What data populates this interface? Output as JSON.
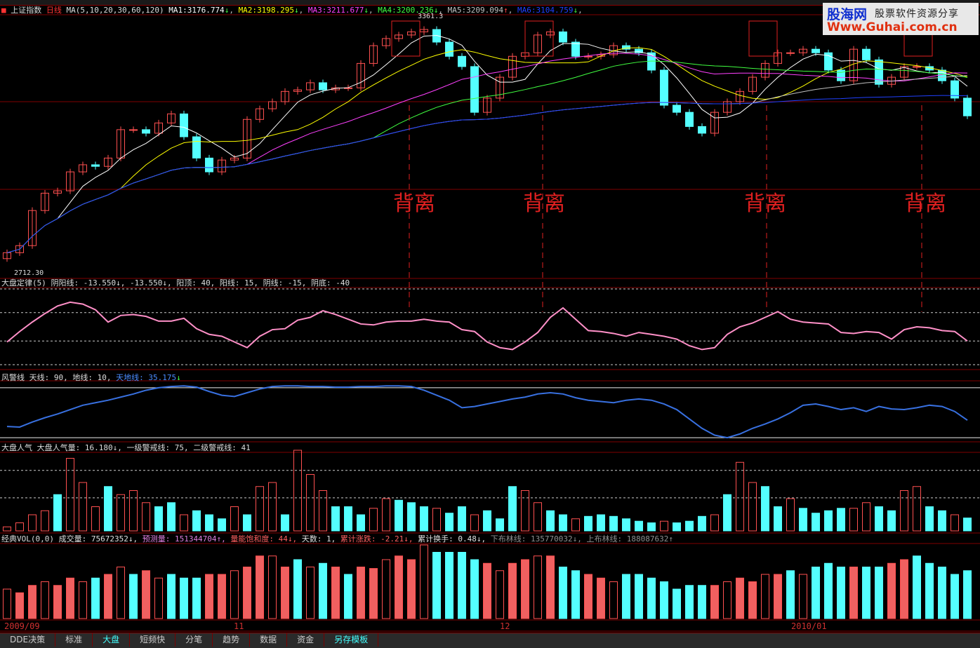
{
  "header": {
    "title": "上证指数",
    "period": "日线",
    "ma_params": "MA(5,10,20,30,60,120)",
    "ma": [
      {
        "label": "MA1:",
        "value": "3176.774",
        "arrow": "↓",
        "color": "#ffffff"
      },
      {
        "label": "MA2:",
        "value": "3198.295",
        "arrow": "↓",
        "color": "#ffff00"
      },
      {
        "label": "MA3:",
        "value": "3211.677",
        "arrow": "↓",
        "color": "#ff40ff"
      },
      {
        "label": "MA4:",
        "value": "3200.236",
        "arrow": "↓",
        "color": "#40ff40"
      },
      {
        "label": "MA5:",
        "value": "3209.094",
        "arrow": "↑",
        "color": "#c0c0c0"
      },
      {
        "label": "MA6:",
        "value": "3104.759",
        "arrow": "↓",
        "color": "#2040ff"
      }
    ]
  },
  "price_labels": {
    "high": "3361.3",
    "low": "2712.30"
  },
  "annotation_text": "背离",
  "panels": {
    "dpdl": {
      "title": "大盘定律(5)",
      "items": [
        "阴阳线: -13.550↓, -13.550↓, 阳顶: 40, 阳线: 15, 阴线: -15, 阴底: -40"
      ]
    },
    "fjx": {
      "title": "风警线",
      "fixed": "天线: 90, 地线: 10, ",
      "line_label": "天地线: 35.175",
      "arrow": "↓"
    },
    "rq": {
      "title": "大盘人气",
      "text": "大盘人气量: 16.180↓, 一级警戒线: 75, 二级警戒线: 41"
    },
    "vol": {
      "title": "经典VOL(0,0)",
      "parts": [
        {
          "t": "成交量: 75672352↓, ",
          "c": "#e0e0e0"
        },
        {
          "t": "预测量: 151344704↑, ",
          "c": "#e080e0"
        },
        {
          "t": "量能饱和度: 44↓, ",
          "c": "#ff6060"
        },
        {
          "t": "天数: 1, ",
          "c": "#e0e0e0"
        },
        {
          "t": "累计涨跌: -2.21↓, ",
          "c": "#ff6060"
        },
        {
          "t": "累计换手: 0.48↓, ",
          "c": "#e0e0e0"
        },
        {
          "t": "下布林线: 135770032↓, ",
          "c": "#909090"
        },
        {
          "t": "上布林线: 188087632↑",
          "c": "#909090"
        }
      ]
    }
  },
  "dates": [
    "2009/09",
    "11",
    "12",
    "2010/01"
  ],
  "tabs": [
    "DDE决策",
    "标准",
    "大盘",
    "短频快",
    "分笔",
    "趋势",
    "数据",
    "资金",
    "另存模板"
  ],
  "logo": {
    "name": "股海网",
    "slogan": "股票软件资源分享",
    "url": "Www.Guhai.com.cn"
  },
  "colors": {
    "up": "#ff5050",
    "down": "#54ffff",
    "grid": "#800000"
  },
  "chart_data": {
    "type": "candlestick",
    "ylim": [
      2712.3,
      3361.3
    ],
    "close": [
      2765,
      2783,
      2872,
      2916,
      2922,
      2970,
      2988,
      2984,
      3005,
      3077,
      3077,
      3068,
      3094,
      3117,
      3059,
      3005,
      2970,
      3000,
      3005,
      3103,
      3130,
      3148,
      3174,
      3178,
      3196,
      3178,
      3183,
      3183,
      3245,
      3290,
      3308,
      3317,
      3325,
      3331,
      3299,
      3263,
      3237,
      3121,
      3157,
      3210,
      3263,
      3272,
      3317,
      3325,
      3299,
      3263,
      3263,
      3267,
      3290,
      3281,
      3272,
      3228,
      3139,
      3121,
      3085,
      3068,
      3121,
      3148,
      3174,
      3210,
      3245,
      3272,
      3272,
      3281,
      3272,
      3228,
      3201,
      3281,
      3254,
      3192,
      3210,
      3237,
      3237,
      3228,
      3201,
      3157,
      3112
    ],
    "ma_periods": [
      5,
      10,
      20,
      30,
      60,
      120
    ],
    "dpdl": {
      "ylim": [
        -40,
        40
      ],
      "levels": [
        40,
        15,
        -15,
        -40
      ],
      "values": [
        -16,
        -5,
        5,
        14,
        22,
        26,
        24,
        18,
        5,
        12,
        13,
        11,
        6,
        6,
        9,
        -2,
        -8,
        -10,
        -16,
        -22,
        -10,
        -3,
        -2,
        7,
        10,
        17,
        13,
        8,
        3,
        2,
        5,
        6,
        6,
        8,
        6,
        5,
        -3,
        -5,
        -16,
        -22,
        -24,
        -16,
        -6,
        10,
        20,
        8,
        -4,
        -5,
        -7,
        -10,
        -6,
        -8,
        -10,
        -13,
        -20,
        -24,
        -22,
        -8,
        0,
        4,
        10,
        16,
        8,
        5,
        4,
        3,
        -6,
        -7,
        -5,
        -6,
        -13,
        -3,
        0,
        -1,
        -4,
        -5,
        -15
      ]
    },
    "fjx": {
      "ylim": [
        0,
        100
      ],
      "levels": [
        90,
        10
      ],
      "values": [
        28,
        27,
        35,
        42,
        48,
        55,
        62,
        66,
        70,
        75,
        80,
        86,
        90,
        92,
        93,
        91,
        84,
        78,
        76,
        82,
        88,
        92,
        93,
        93,
        92,
        92,
        91,
        91,
        92,
        92,
        93,
        93,
        92,
        86,
        78,
        70,
        58,
        60,
        64,
        68,
        72,
        75,
        80,
        82,
        80,
        74,
        70,
        68,
        66,
        70,
        72,
        70,
        64,
        55,
        40,
        25,
        14,
        10,
        16,
        25,
        32,
        40,
        50,
        62,
        64,
        60,
        55,
        58,
        52,
        60,
        56,
        55,
        58,
        62,
        60,
        52,
        38
      ]
    },
    "rq": {
      "ylim": [
        0,
        100
      ],
      "levels": [
        75,
        41
      ],
      "values": [
        5,
        10,
        20,
        25,
        45,
        90,
        60,
        30,
        55,
        45,
        50,
        35,
        30,
        35,
        20,
        25,
        20,
        15,
        30,
        20,
        55,
        60,
        20,
        100,
        70,
        50,
        30,
        30,
        20,
        28,
        40,
        38,
        35,
        30,
        28,
        22,
        30,
        20,
        25,
        15,
        55,
        50,
        35,
        25,
        20,
        15,
        18,
        20,
        18,
        15,
        12,
        10,
        12,
        10,
        12,
        18,
        20,
        45,
        85,
        60,
        55,
        30,
        40,
        28,
        22,
        25,
        28,
        28,
        35,
        30,
        25,
        50,
        55,
        30,
        25,
        20,
        16
      ],
      "filled": [
        0,
        0,
        0,
        0,
        1,
        0,
        0,
        0,
        1,
        0,
        0,
        0,
        1,
        1,
        0,
        1,
        1,
        1,
        0,
        1,
        0,
        0,
        1,
        0,
        0,
        0,
        1,
        1,
        1,
        0,
        0,
        1,
        1,
        1,
        0,
        1,
        1,
        0,
        1,
        1,
        1,
        0,
        0,
        1,
        1,
        0,
        1,
        1,
        1,
        1,
        1,
        1,
        0,
        1,
        1,
        1,
        0,
        1,
        0,
        0,
        1,
        1,
        0,
        1,
        1,
        1,
        1,
        0,
        0,
        1,
        1,
        0,
        0,
        1,
        1,
        0,
        1
      ]
    },
    "vol": {
      "values": [
        40,
        35,
        45,
        50,
        45,
        55,
        50,
        55,
        60,
        70,
        60,
        65,
        55,
        60,
        55,
        55,
        60,
        60,
        65,
        70,
        85,
        85,
        70,
        80,
        70,
        75,
        70,
        60,
        70,
        68,
        80,
        85,
        80,
        100,
        90,
        90,
        90,
        80,
        75,
        65,
        75,
        80,
        85,
        85,
        70,
        65,
        60,
        55,
        50,
        60,
        60,
        55,
        50,
        40,
        45,
        45,
        45,
        50,
        55,
        50,
        60,
        60,
        65,
        60,
        70,
        75,
        70,
        70,
        70,
        70,
        75,
        80,
        85,
        75,
        70,
        60,
        65
      ],
      "up": [
        1,
        1,
        1,
        1,
        1,
        1,
        1,
        0,
        1,
        1,
        0,
        1,
        1,
        0,
        0,
        0,
        1,
        1,
        1,
        1,
        1,
        1,
        1,
        0,
        1,
        0,
        1,
        0,
        1,
        1,
        1,
        1,
        1,
        1,
        0,
        0,
        0,
        0,
        1,
        1,
        1,
        1,
        1,
        1,
        0,
        0,
        1,
        1,
        1,
        0,
        0,
        0,
        0,
        0,
        0,
        0,
        1,
        1,
        1,
        1,
        1,
        1,
        0,
        1,
        0,
        0,
        0,
        1,
        0,
        0,
        1,
        1,
        0,
        0,
        0,
        0,
        0
      ]
    }
  }
}
